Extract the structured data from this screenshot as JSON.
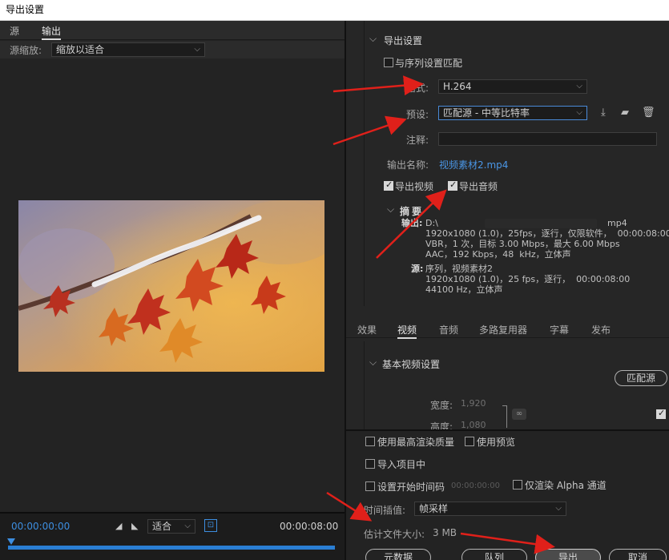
{
  "window": {
    "title": "导出设置"
  },
  "left": {
    "tabs": [
      {
        "label": "源"
      },
      {
        "label": "输出"
      }
    ],
    "source_scale_label": "源缩放:",
    "source_scale_value": "缩放以适合",
    "timeline": {
      "current_time": "00:00:00:00",
      "fit_value": "适合",
      "end_time": "00:00:08:00",
      "in_marker_icon": "in-point-icon",
      "out_marker_icon": "out-point-icon"
    }
  },
  "export_settings": {
    "section_title": "导出设置",
    "match_sequence_label": "与序列设置匹配",
    "match_sequence_checked": false,
    "format_label": "格式:",
    "format_value": "H.264",
    "preset_label": "预设:",
    "preset_value": "匹配源 - 中等比特率",
    "comment_label": "注释:",
    "comment_value": "",
    "output_name_label": "输出名称:",
    "output_name_value": "视频素材2.mp4",
    "export_video_label": "导出视频",
    "export_video_checked": true,
    "export_audio_label": "导出音频",
    "export_audio_checked": true
  },
  "summary": {
    "title": "摘要",
    "output_label": "输出:",
    "output_path": "D:\\",
    "output_ext": "mp4",
    "output_line2": "1920x1080 (1.0)，25fps，逐行，仅限软件，  00:00:08:00",
    "output_line3": "VBR，1 次，目标 3.00 Mbps，最大 6.00 Mbps",
    "output_line4": "AAC，192 Kbps，48  kHz，立体声",
    "source_label": "源:",
    "source_line1": "序列，视频素材2",
    "source_line2": "1920x1080 (1.0)，25 fps，逐行，  00:00:08:00",
    "source_line3": "44100 Hz，立体声"
  },
  "settings_tabs": [
    {
      "label": "效果"
    },
    {
      "label": "视频"
    },
    {
      "label": "音频"
    },
    {
      "label": "多路复用器"
    },
    {
      "label": "字幕"
    },
    {
      "label": "发布"
    }
  ],
  "video_settings": {
    "title": "基本视频设置",
    "match_source_button": "匹配源",
    "width_label": "宽度:",
    "width_value": "1,920",
    "height_label": "高度:",
    "height_value": "1,080"
  },
  "bottom": {
    "max_render_quality": "使用最高渲染质量",
    "use_previews": "使用预览",
    "import_into_project": "导入项目中",
    "set_start_timecode": "设置开始时间码",
    "start_timecode_value": "00:00:00:00",
    "render_alpha_only": "仅渲染 Alpha 通道",
    "time_interpolation_label": "时间插值:",
    "time_interpolation_value": "帧采样",
    "estimated_size_label": "估计文件大小:",
    "estimated_size_value": "3 MB",
    "metadata_button": "元数据",
    "queue_button": "队列",
    "export_button": "导出",
    "cancel_button": "取消"
  },
  "colors": {
    "accent_blue": "#3d8ee0",
    "annotation_red": "#e0201a"
  }
}
